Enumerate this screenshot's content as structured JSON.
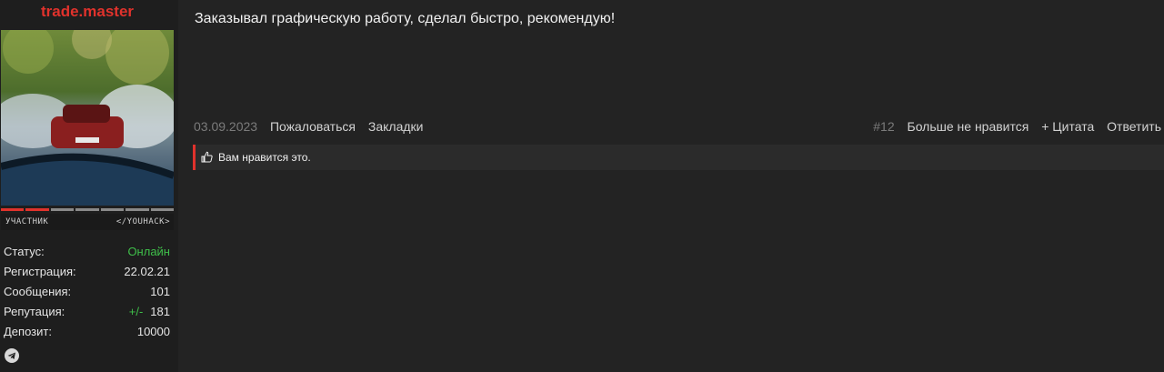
{
  "user": {
    "username": "trade.master",
    "rank_left": "УЧАСТНИК",
    "rank_right": "</YOUHACK>",
    "rank_progress": 0.29
  },
  "stats": {
    "status_label": "Статус:",
    "status_value": "Онлайн",
    "reg_label": "Регистрация:",
    "reg_value": "22.02.21",
    "msgs_label": "Сообщения:",
    "msgs_value": "101",
    "rep_label": "Репутация:",
    "rep_sign": "+/-",
    "rep_value": "181",
    "deposit_label": "Депозит:",
    "deposit_value": "10000"
  },
  "post": {
    "text": "Заказывал графическую работу, сделал быстро, рекомендую!",
    "date": "03.09.2023",
    "report": "Пожаловаться",
    "bookmarks": "Закладки",
    "number": "#12",
    "unlike": "Больше не нравится",
    "quote": "+ Цитата",
    "reply": "Ответить",
    "likes_text": "Вам нравится это."
  },
  "colors": {
    "accent": "#e0322c",
    "online": "#3fbf4a",
    "background": "#232323"
  }
}
